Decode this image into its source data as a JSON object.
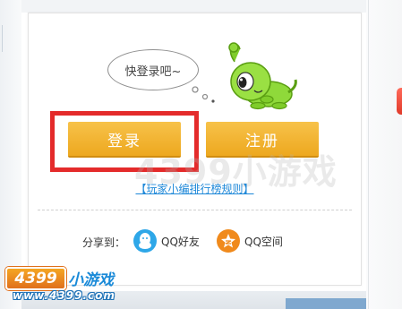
{
  "dialog": {
    "bubble_text": "快登录吧~",
    "login_label": "登录",
    "register_label": "注册",
    "rules_link": "【玩家小编排行榜规则】",
    "share_label": "分享到：",
    "share_qq": "QQ好友",
    "share_qzone": "QQ空间"
  },
  "watermark": {
    "center": "4399小游戏"
  },
  "logo": {
    "badge": "4399",
    "text": "小游戏",
    "url": "www.4399.com"
  },
  "colors": {
    "button": "#eda81f",
    "highlight": "#e42b2b",
    "link": "#1e88d8",
    "qq": "#2ea7e8",
    "qzone": "#f08a1c"
  },
  "icons": {
    "qq": "qq-penguin-icon",
    "qzone": "qzone-star-icon",
    "mascot": "green-mascot-icon"
  }
}
